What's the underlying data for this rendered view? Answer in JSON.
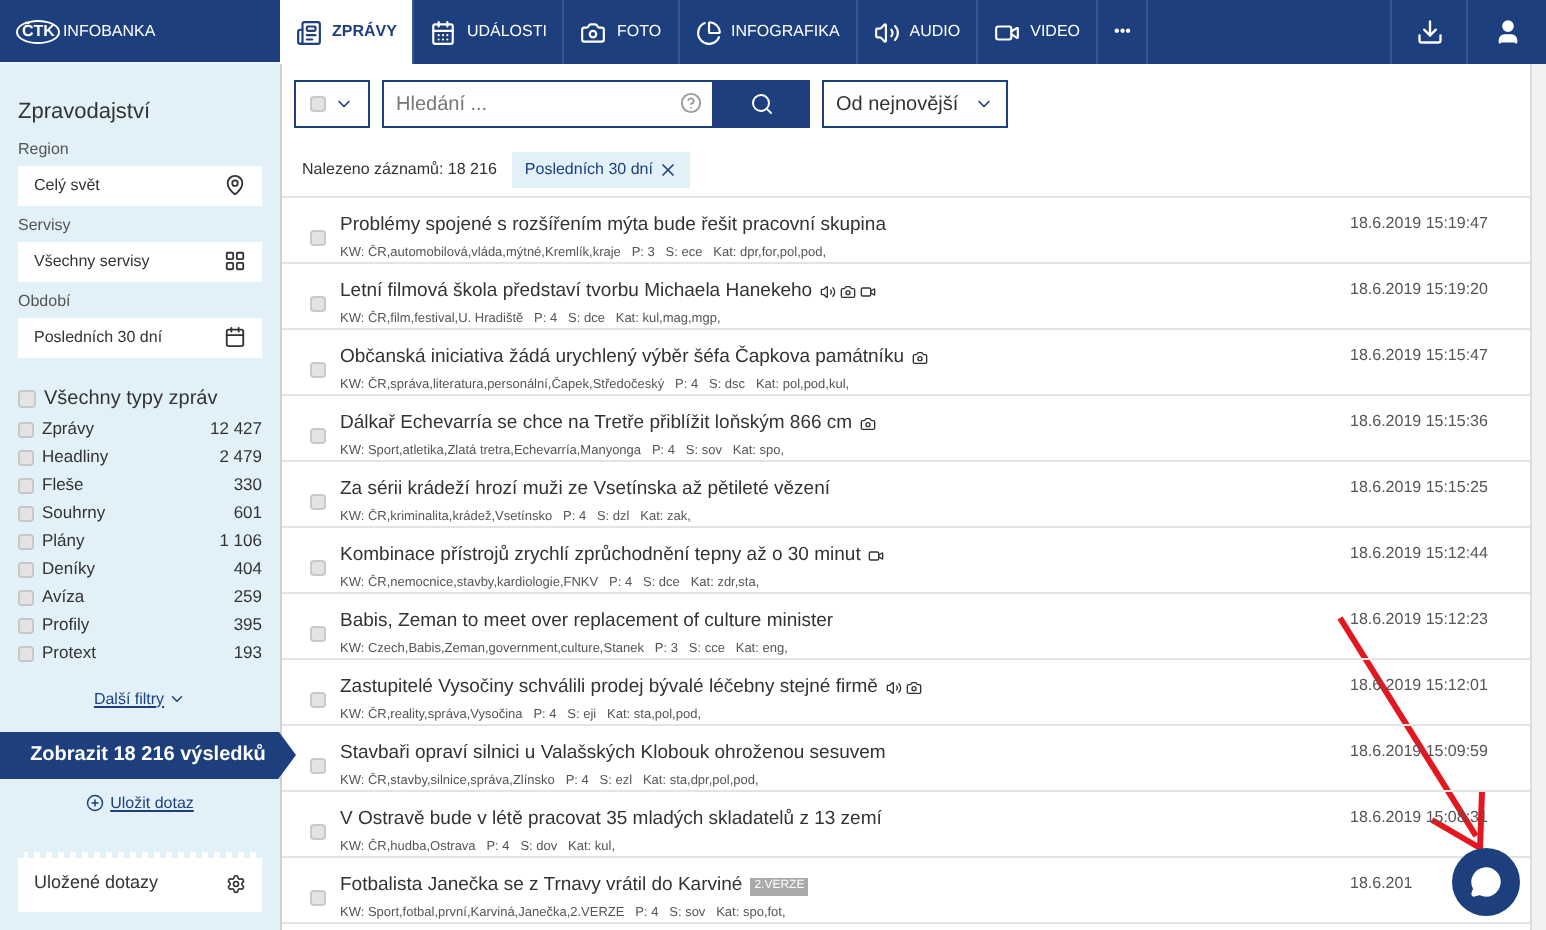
{
  "logo": {
    "mark": "ČTK",
    "text": "INFOBANKA"
  },
  "tabs": [
    {
      "label": "ZPRÁVY",
      "kind": "news",
      "selected": true
    },
    {
      "label": "UDÁLOSTI",
      "kind": "events",
      "selected": false
    },
    {
      "label": "FOTO",
      "kind": "photo",
      "selected": false
    },
    {
      "label": "INFOGRAFIKA",
      "kind": "infographic",
      "selected": false
    },
    {
      "label": "AUDIO",
      "kind": "audio",
      "selected": false
    },
    {
      "label": "VIDEO",
      "kind": "video",
      "selected": false
    },
    {
      "label": "•••",
      "kind": "more",
      "selected": false
    }
  ],
  "sidebar": {
    "title": "Zpravodajství",
    "fields": [
      {
        "label": "Region",
        "value": "Celý svět",
        "kind": "region"
      },
      {
        "label": "Servisy",
        "value": "Všechny servisy",
        "kind": "services"
      },
      {
        "label": "Období",
        "value": "Posledních 30 dní",
        "kind": "period"
      }
    ],
    "all_types": {
      "label": "Všechny typy zpráv",
      "checked": false
    },
    "types": [
      {
        "label": "Zprávy",
        "count": "12 427",
        "checked": false
      },
      {
        "label": "Headliny",
        "count": "2 479",
        "checked": false
      },
      {
        "label": "Fleše",
        "count": "330",
        "checked": false
      },
      {
        "label": "Souhrny",
        "count": "601",
        "checked": false
      },
      {
        "label": "Plány",
        "count": "1 106",
        "checked": false
      },
      {
        "label": "Deníky",
        "count": "404",
        "checked": false
      },
      {
        "label": "Avíza",
        "count": "259",
        "checked": false
      },
      {
        "label": "Profily",
        "count": "395",
        "checked": false
      },
      {
        "label": "Protext",
        "count": "193",
        "checked": false
      }
    ],
    "more_filters": "Další filtry",
    "show_button": "Zobrazit 18 216 výsledků",
    "save_query": "Uložit dotaz",
    "saved_queries": "Uložené dotazy"
  },
  "toolbar": {
    "select_all_checked": false,
    "search_placeholder": "Hledání ...",
    "sort": "Od nejnovější"
  },
  "found": {
    "label": "Nalezeno záznamů: 18 216",
    "filter_chip": "Posledních 30 dní"
  },
  "rows": [
    {
      "title": "Problémy spojené s rozšířením mýta bude řešit pracovní skupina",
      "meta": "KW: ČR,automobilová,vláda,mýtné,Kremlík,kraje   P: 3   S: ece   Kat: dpr,for,pol,pod,",
      "time": "18.6.2019 15:19:47",
      "checked": false,
      "audio": false,
      "photo": false,
      "video": false
    },
    {
      "title": "Letní filmová škola představí tvorbu Michaela Hanekeho",
      "meta": "KW: ČR,film,festival,U. Hradiště   P: 4   S: dce   Kat: kul,mag,mgp,",
      "time": "18.6.2019 15:19:20",
      "checked": false,
      "audio": true,
      "photo": true,
      "video": true
    },
    {
      "title": "Občanská iniciativa žádá urychlený výběr šéfa Čapkova památníku",
      "meta": "KW: ČR,správa,literatura,personální,Čapek,Středočeský   P: 4   S: dsc   Kat: pol,pod,kul,",
      "time": "18.6.2019 15:15:47",
      "checked": false,
      "audio": false,
      "photo": true,
      "video": false
    },
    {
      "title": "Dálkař Echevarría se chce na Tretře přiblížit loňským 866 cm",
      "meta": "KW: Sport,atletika,Zlatá tretra,Echevarría,Manyonga   P: 4   S: sov   Kat: spo,",
      "time": "18.6.2019 15:15:36",
      "checked": false,
      "audio": false,
      "photo": true,
      "video": false
    },
    {
      "title": "Za sérii krádeží hrozí muži ze Vsetínska až pětileté vězení",
      "meta": "KW: ČR,kriminalita,krádež,Vsetínsko   P: 4   S: dzl   Kat: zak,",
      "time": "18.6.2019 15:15:25",
      "checked": false,
      "audio": false,
      "photo": false,
      "video": false
    },
    {
      "title": "Kombinace přístrojů zrychlí zprůchodnění tepny až o 30 minut",
      "meta": "KW: ČR,nemocnice,stavby,kardiologie,FNKV   P: 4   S: dce   Kat: zdr,sta,",
      "time": "18.6.2019 15:12:44",
      "checked": false,
      "audio": false,
      "photo": false,
      "video": true
    },
    {
      "title": "Babis, Zeman to meet over replacement of culture minister",
      "meta": "KW: Czech,Babis,Zeman,government,culture,Stanek   P: 3   S: cce   Kat: eng,",
      "time": "18.6.2019 15:12:23",
      "checked": false,
      "audio": false,
      "photo": false,
      "video": false
    },
    {
      "title": "Zastupitelé Vysočiny schválili prodej bývalé léčebny stejné firmě",
      "meta": "KW: ČR,reality,správa,Vysočina   P: 4   S: eji   Kat: sta,pol,pod,",
      "time": "18.6.2019 15:12:01",
      "checked": false,
      "audio": true,
      "photo": true,
      "video": false
    },
    {
      "title": "Stavbaři opraví silnici u Valašských Klobouk ohroženou sesuvem",
      "meta": "KW: ČR,stavby,silnice,správa,Zlínsko   P: 4   S: ezl   Kat: sta,dpr,pol,pod,",
      "time": "18.6.2019 15:09:59",
      "checked": false,
      "audio": false,
      "photo": false,
      "video": false
    },
    {
      "title": "V Ostravě bude v létě pracovat 35 mladých skladatelů z 13 zemí",
      "meta": "KW: ČR,hudba,Ostrava   P: 4   S: dov   Kat: kul,",
      "time": "18.6.2019 15:08:31",
      "checked": false,
      "audio": false,
      "photo": false,
      "video": false
    },
    {
      "title": "Fotbalista Janečka se z Trnavy vrátil do Karviné",
      "badge": "2.VERZE",
      "meta": "KW: Sport,fotbal,první,Karviná,Janečka,2.VERZE   P: 4   S: sov   Kat: spo,fot,",
      "time": "18.6.201",
      "checked": false,
      "audio": false,
      "photo": false,
      "video": false
    }
  ]
}
